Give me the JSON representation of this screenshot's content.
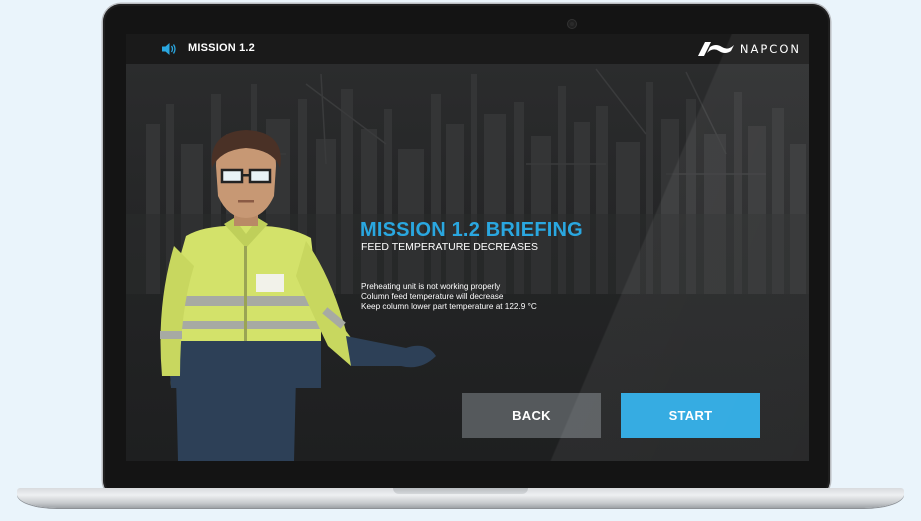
{
  "header": {
    "mission_label": "MISSION 1.2",
    "brand_name": "NAPCON",
    "speaker_icon": "speaker-icon"
  },
  "briefing": {
    "title": "MISSION 1.2 BRIEFING",
    "subtitle": "FEED TEMPERATURE DECREASES",
    "lines": [
      "Preheating unit is not working properly",
      "Column feed temperature will decrease",
      "Keep column lower part temperature at 122.9 °C"
    ]
  },
  "buttons": {
    "back_label": "BACK",
    "start_label": "START"
  },
  "colors": {
    "accent": "#2aa7e0",
    "back_button": "#55595c",
    "background": "#eaf4fb"
  }
}
